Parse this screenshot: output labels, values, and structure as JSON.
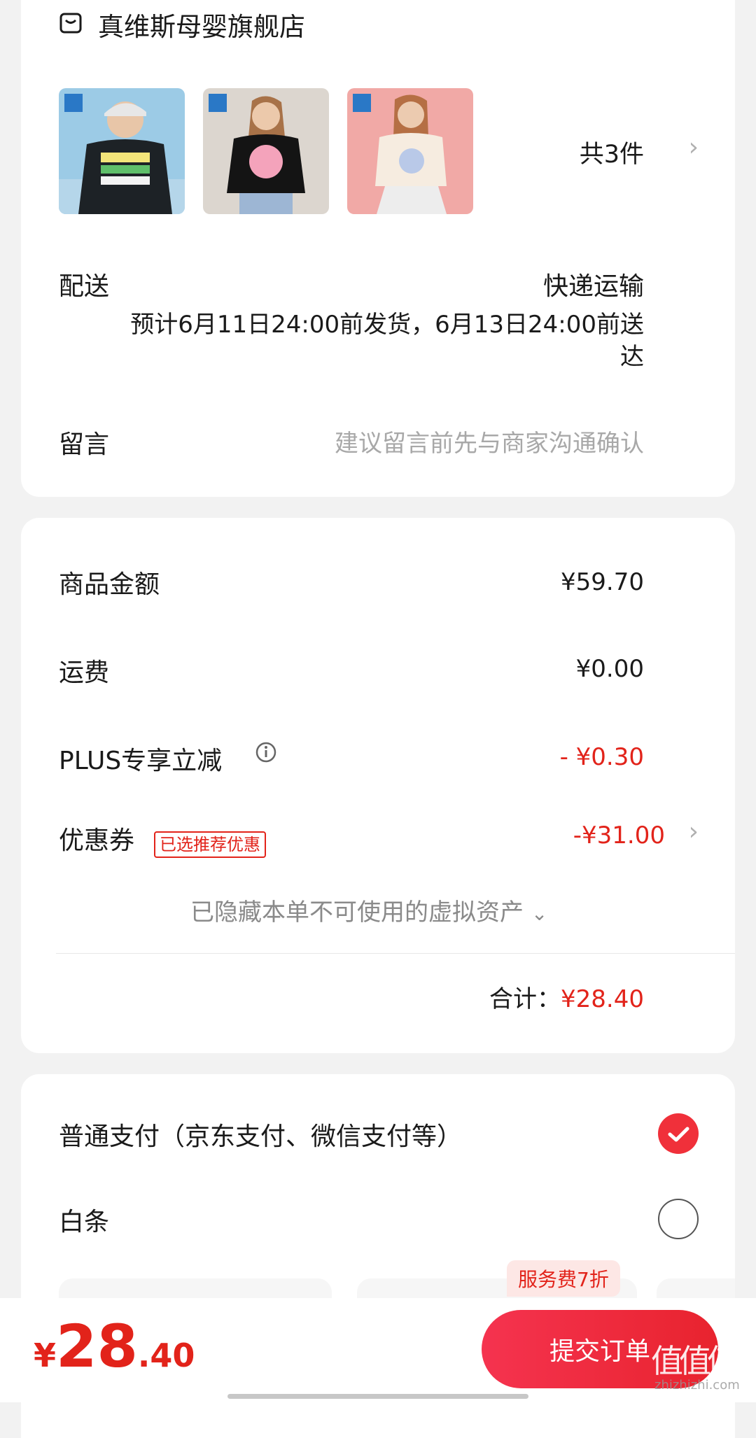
{
  "store": {
    "name": "真维斯母婴旗舰店",
    "item_count": "共3件"
  },
  "delivery": {
    "label": "配送",
    "method": "快递运输",
    "estimate_line1": "预计6月11日24:00前发货，6月13日24:00前送",
    "estimate_line2": "达"
  },
  "message": {
    "label": "留言",
    "placeholder": "建议留言前先与商家沟通确认"
  },
  "price": {
    "goods_label": "商品金额",
    "goods_value": "¥59.70",
    "shipping_label": "运费",
    "shipping_value": "¥0.00",
    "plus_label": "PLUS专享立减",
    "plus_value": "- ¥0.30",
    "coupon_label": "优惠券",
    "coupon_tag": "已选推荐优惠",
    "coupon_value": "-¥31.00",
    "hidden_assets": "已隐藏本单不可使用的虚拟资产",
    "total_label": "合计：",
    "total_value": "¥28.40"
  },
  "payment": {
    "normal_label": "普通支付（京东支付、微信支付等）",
    "baitiao_label": "白条",
    "service_tag": "服务费7折"
  },
  "bottom": {
    "currency": "¥",
    "integer": "28",
    "decimal": ".40",
    "submit_label": "提交订单"
  },
  "watermark": {
    "text": "值值值",
    "site": "zhizhizhi.com"
  },
  "colors": {
    "accent": "#e2231a",
    "background": "#f2f2f2"
  }
}
